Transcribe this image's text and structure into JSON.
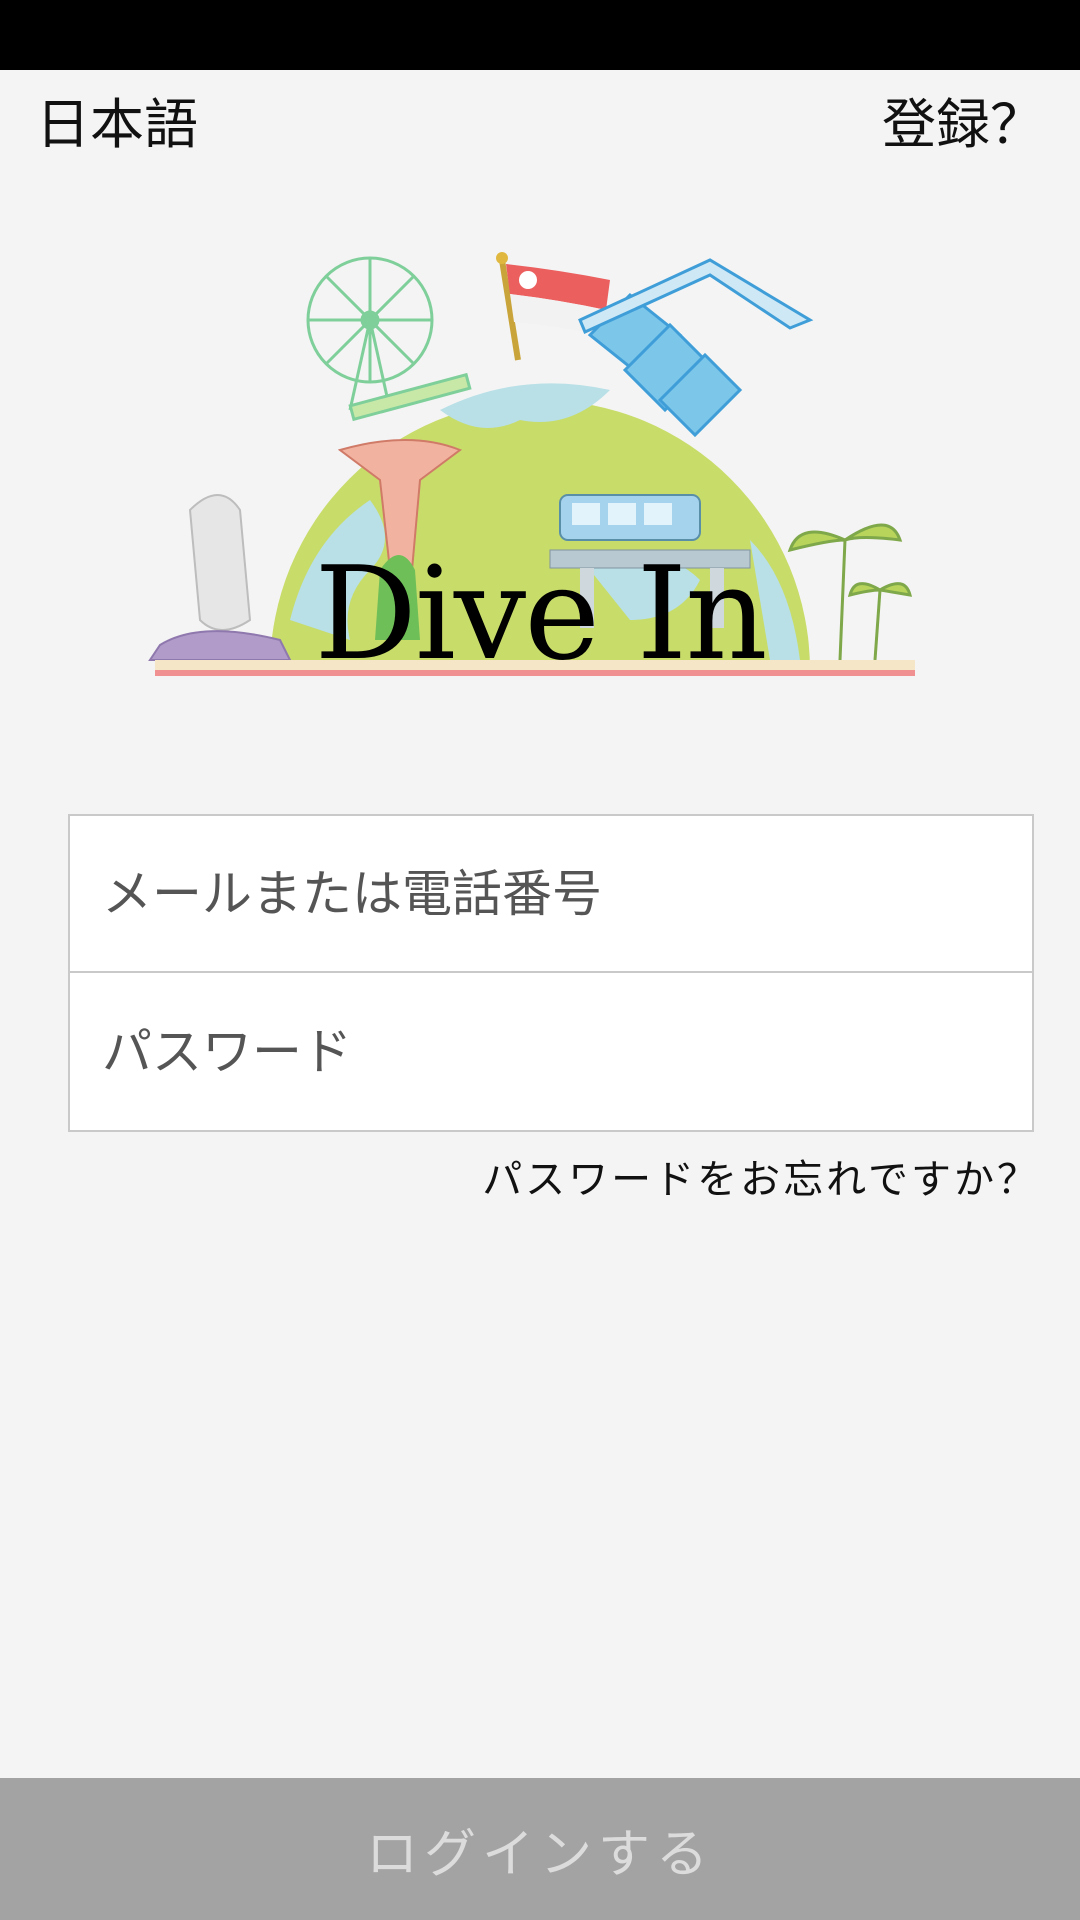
{
  "header": {
    "language_label": "日本語",
    "register_label": "登録？"
  },
  "brand": {
    "title": "Dive In",
    "illustration": "singapore-globe-illustration"
  },
  "form": {
    "email_placeholder": "メールまたは電話番号",
    "email_value": "",
    "password_placeholder": "パスワード",
    "password_value": "",
    "forgot_label": "パスワードをお忘れですか？"
  },
  "actions": {
    "login_label": "ログインする"
  },
  "colors": {
    "background": "#f4f4f4",
    "status_bar": "#000000",
    "login_button": "#a3a3a3",
    "login_text": "#dcdcdc",
    "field_border": "#c9c9c9"
  }
}
